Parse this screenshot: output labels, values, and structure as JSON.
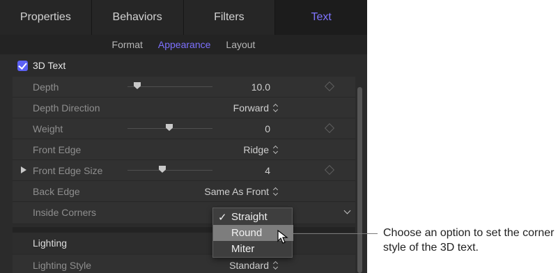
{
  "tabs": [
    "Properties",
    "Behaviors",
    "Filters",
    "Text"
  ],
  "subtabs": [
    "Format",
    "Appearance",
    "Layout"
  ],
  "section": {
    "label": "3D Text",
    "checked": true
  },
  "params": {
    "depth": {
      "label": "Depth",
      "value": "10.0"
    },
    "depth_direction": {
      "label": "Depth Direction",
      "value": "Forward"
    },
    "weight": {
      "label": "Weight",
      "value": "0"
    },
    "front_edge": {
      "label": "Front Edge",
      "value": "Ridge"
    },
    "front_edge_size": {
      "label": "Front Edge Size",
      "value": "4"
    },
    "back_edge": {
      "label": "Back Edge",
      "value": "Same As Front"
    },
    "inside_corners": {
      "label": "Inside Corners"
    },
    "lighting": {
      "label": "Lighting"
    },
    "lighting_style": {
      "label": "Lighting Style",
      "value": "Standard"
    }
  },
  "menu": {
    "check": "✓",
    "items": [
      "Straight",
      "Round",
      "Miter"
    ],
    "selected": "Straight",
    "highlighted": "Round"
  },
  "callout": "Choose an option to set the corner style of the 3D text.",
  "colors": {
    "accent": "#7d71ff",
    "checkbox": "#5c61f5",
    "panel": "#2b2b2b"
  }
}
